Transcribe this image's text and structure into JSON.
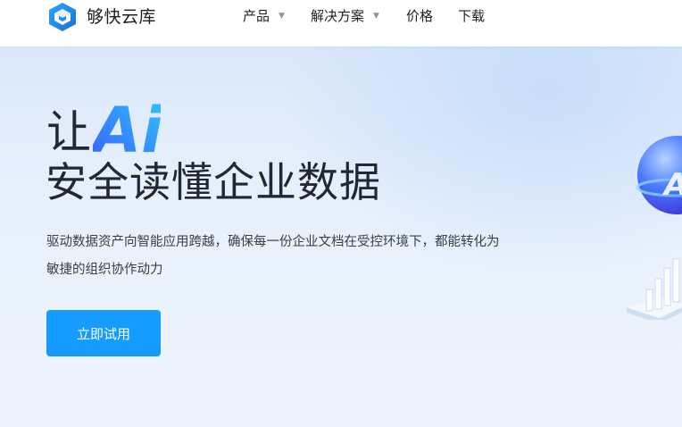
{
  "navbar": {
    "brand": "够快云库",
    "items": [
      {
        "label": "产品",
        "caret": "▼"
      },
      {
        "label": "解决方案",
        "caret": "▼"
      },
      {
        "label": "价格"
      },
      {
        "label": "下载"
      }
    ]
  },
  "hero": {
    "title_prefix": "让",
    "title_ai": "Ai",
    "title_line2": "安全读懂企业数据",
    "description": "驱动数据资产向智能应用跨越，确保每一份企业文档在受控环境下，都能转化为敏捷的组织协作动力",
    "cta_label": "立即试用"
  },
  "colors": {
    "accent": "#169bff",
    "ai_gradient_start": "#3a5cff",
    "ai_gradient_end": "#2fc6ff",
    "logo_blue": "#1c8ff0"
  },
  "icons": {
    "logo": "box-cube-logo-icon",
    "caret": "chevron-down-icon",
    "sphere": "ai-sphere-icon",
    "chart": "bar-chart-icon"
  }
}
